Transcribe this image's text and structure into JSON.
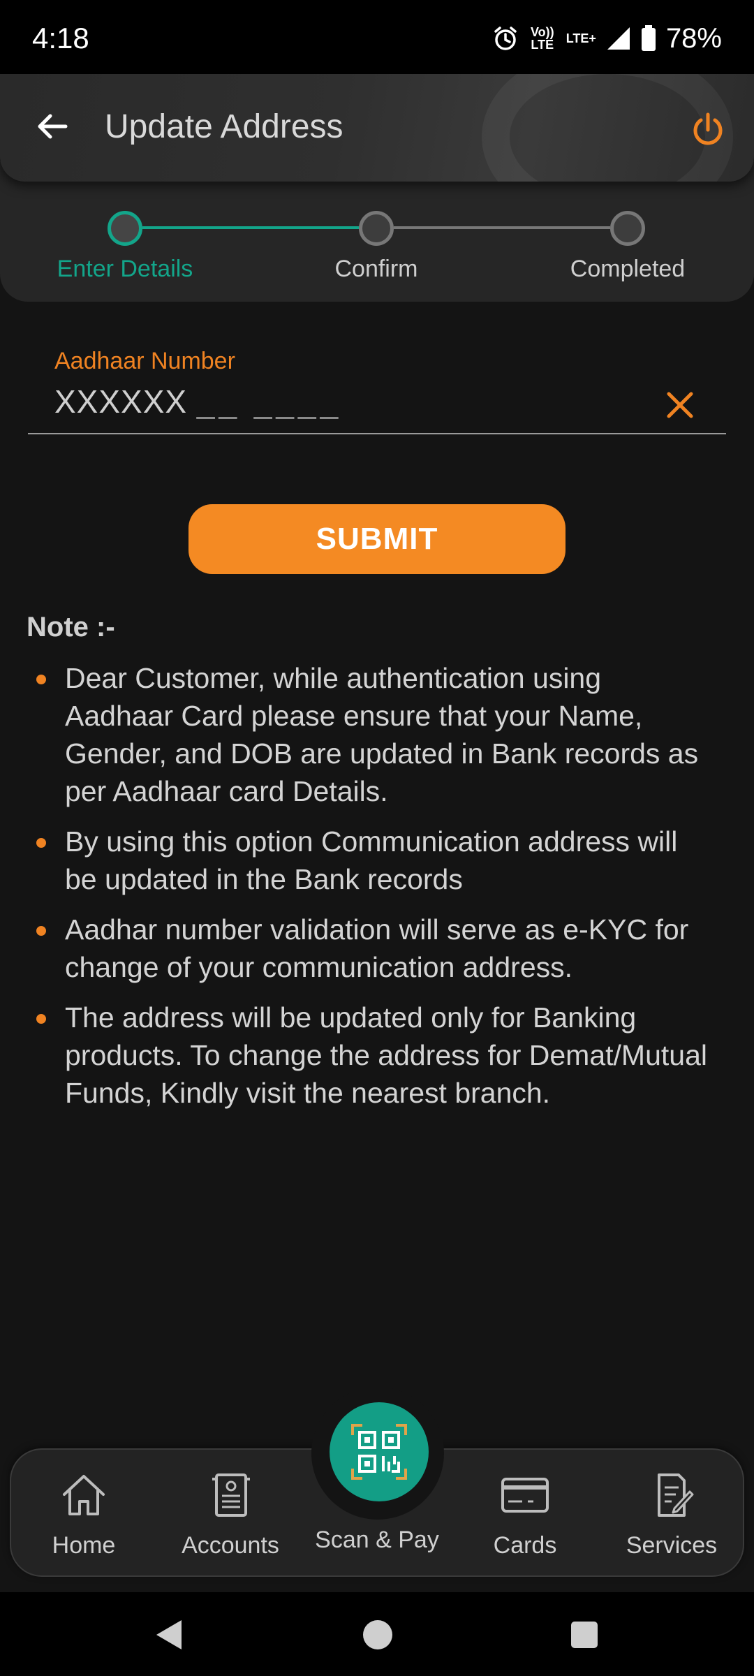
{
  "status_bar": {
    "time": "4:18",
    "volte": "Vo)) LTE",
    "lte": "LTE+",
    "battery": "78%"
  },
  "header": {
    "title": "Update Address"
  },
  "stepper": {
    "steps": [
      {
        "label": "Enter Details",
        "state": "active"
      },
      {
        "label": "Confirm",
        "state": "pending"
      },
      {
        "label": "Completed",
        "state": "pending"
      }
    ]
  },
  "form": {
    "aadhaar_label": "Aadhaar Number",
    "aadhaar_value": "XXXXXX",
    "aadhaar_mask": "__ ____"
  },
  "submit_label": "SUBMIT",
  "note": {
    "title": "Note :-",
    "items": [
      "Dear Customer, while authentication using Aadhaar Card please ensure that your Name, Gender, and DOB are updated in Bank records as per Aadhaar card Details.",
      "By using this option Communication address will be updated in the Bank records",
      "Aadhar number validation will serve as e-KYC for change of your communication address.",
      "The address will be updated only for Banking products. To change the address for Demat/Mutual Funds, Kindly visit the nearest branch."
    ]
  },
  "bottom_nav": {
    "home": "Home",
    "accounts": "Accounts",
    "scan_pay": "Scan & Pay",
    "cards": "Cards",
    "services": "Services"
  },
  "colors": {
    "accent_orange": "#f48a23",
    "accent_teal": "#13a58a",
    "background": "#141414"
  }
}
